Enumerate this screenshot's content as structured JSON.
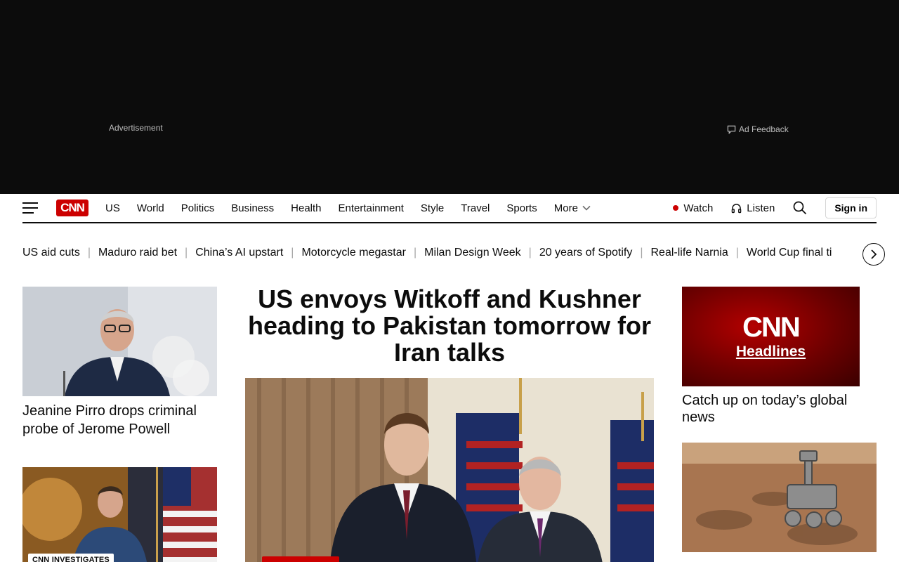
{
  "ad": {
    "label": "Advertisement",
    "feedback": "Ad Feedback"
  },
  "nav": {
    "logo": "CNN",
    "links": [
      "US",
      "World",
      "Politics",
      "Business",
      "Health",
      "Entertainment",
      "Style",
      "Travel",
      "Sports"
    ],
    "more": "More",
    "watch": "Watch",
    "listen": "Listen",
    "signin": "Sign in",
    "colors": {
      "brand": "#cc0000",
      "text": "#0c0c0c"
    }
  },
  "trending": [
    "US aid cuts",
    "Maduro raid bet",
    "China’s AI upstart",
    "Motorcycle megastar",
    "Milan Design Week",
    "20 years of Spotify",
    "Real-life Narnia",
    "World Cup final ti"
  ],
  "left": {
    "story1": {
      "headline": "Jeanine Pirro drops criminal probe of Jerome Powell"
    },
    "story2": {
      "tag": "CNN INVESTIGATES"
    }
  },
  "center": {
    "headline": "US envoys Witkoff and Kushner heading to Pakistan tomorrow for Iran talks"
  },
  "right": {
    "promo": {
      "logo": "CNN",
      "subtitle": "Headlines",
      "headline": "Catch up on today’s global news"
    },
    "story2": {
      "headline": ""
    }
  },
  "icons": [
    "hamburger-icon",
    "chevron-down-icon",
    "headphones-icon",
    "search-icon",
    "chevron-right-icon",
    "comment-icon"
  ]
}
